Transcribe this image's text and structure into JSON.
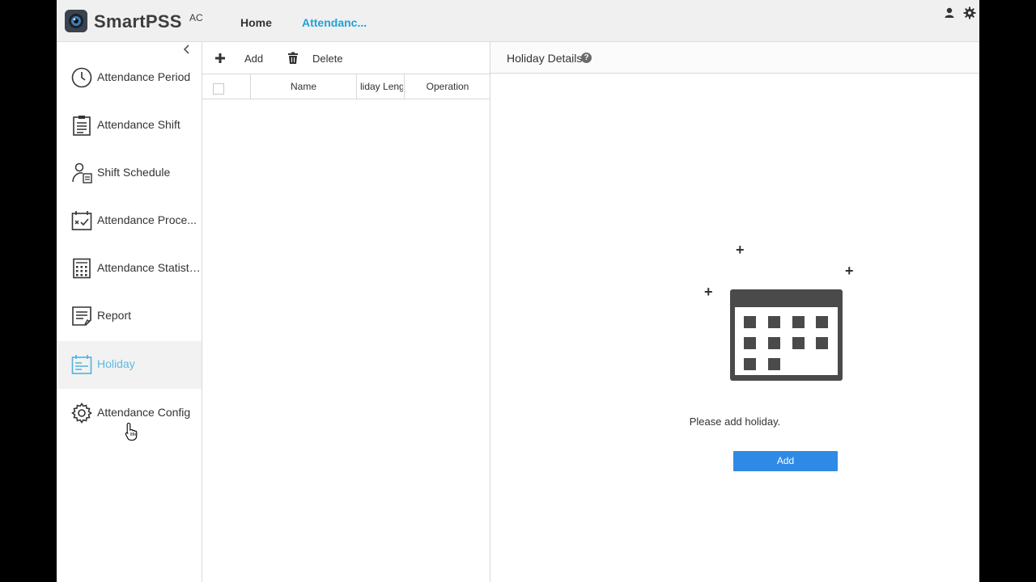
{
  "app": {
    "logo_text": "SmartPSS",
    "logo_sup": "AC"
  },
  "topbar": {
    "tabs": [
      {
        "label": "Home"
      },
      {
        "label": "Attendanc..."
      }
    ],
    "icons": [
      "user-icon",
      "settings-gear-icon"
    ]
  },
  "sidebar": {
    "items": [
      {
        "label": "Attendance Period",
        "icon": "clock-icon"
      },
      {
        "label": "Attendance Shift",
        "icon": "clipboard-icon"
      },
      {
        "label": "Shift Schedule",
        "icon": "person-schedule-icon"
      },
      {
        "label": "Attendance Proce...",
        "icon": "calendar-check-icon"
      },
      {
        "label": "Attendance Statistics",
        "icon": "calculator-icon"
      },
      {
        "label": "Report",
        "icon": "report-icon"
      },
      {
        "label": "Holiday",
        "icon": "holiday-calendar-icon",
        "selected": true
      },
      {
        "label": "Attendance Config",
        "icon": "gear-icon"
      }
    ]
  },
  "list": {
    "toolbar": {
      "add_label": "Add",
      "delete_label": "Delete"
    },
    "columns": [
      "Name",
      "liday Leng",
      "Operation"
    ],
    "rows": []
  },
  "details": {
    "title": "Holiday Details",
    "help_glyph": "?",
    "empty_message": "Please add holiday.",
    "add_button": "Add"
  },
  "colors": {
    "accent": "#1ea2d8",
    "selected_text": "#5bbbe2",
    "button_blue": "#2f8ae6"
  }
}
